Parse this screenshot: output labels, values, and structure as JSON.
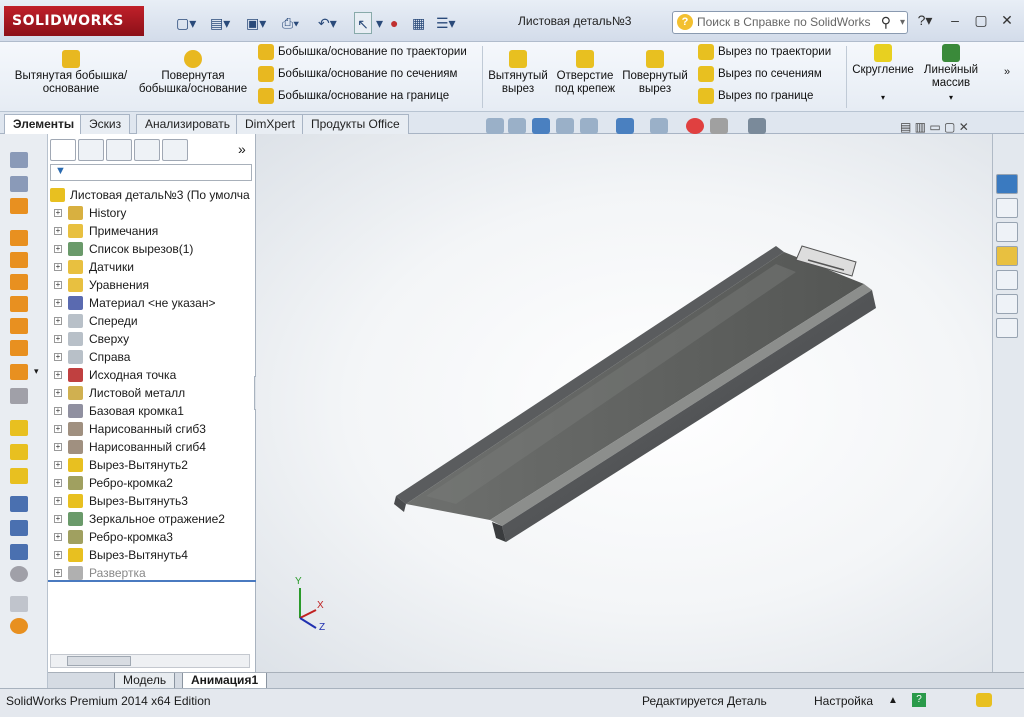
{
  "app": {
    "logo": "SOLIDWORKS",
    "doc_title": "Листовая деталь№3",
    "help_placeholder": "Поиск в Справке по SolidWorks"
  },
  "ribbon": {
    "extrude_boss": "Вытянутая бобышка/основание",
    "revolve_boss": "Повернутая бобышка/основание",
    "swept_boss": "Бобышка/основание по траектории",
    "loft_boss": "Бобышка/основание по сечениям",
    "boundary_boss": "Бобышка/основание на границе",
    "extrude_cut": "Вытянутый вырез",
    "hole_wizard": "Отверстие под крепеж",
    "revolve_cut": "Повернутый вырез",
    "swept_cut": "Вырез по траектории",
    "loft_cut": "Вырез по сечениям",
    "boundary_cut": "Вырез по границе",
    "fillet": "Скругление",
    "linear_pattern": "Линейный массив"
  },
  "tabs": [
    "Элементы",
    "Эскиз",
    "Анализировать",
    "DimXpert",
    "Продукты Office"
  ],
  "tree": {
    "root": "Листовая деталь№3  (По умолча",
    "items": [
      {
        "label": "History",
        "icon": "history-icon",
        "color": "#d8b040"
      },
      {
        "label": "Примечания",
        "icon": "annotations-icon",
        "color": "#e8c040"
      },
      {
        "label": "Список вырезов(1)",
        "icon": "cutlist-icon",
        "color": "#6a9a6a"
      },
      {
        "label": "Датчики",
        "icon": "sensor-icon",
        "color": "#e8c040"
      },
      {
        "label": "Уравнения",
        "icon": "equations-icon",
        "color": "#e8c040"
      },
      {
        "label": "Материал <не указан>",
        "icon": "material-icon",
        "color": "#5a6ab0"
      },
      {
        "label": "Спереди",
        "icon": "plane-icon",
        "color": "#b8c0c8"
      },
      {
        "label": "Сверху",
        "icon": "plane-icon",
        "color": "#b8c0c8"
      },
      {
        "label": "Справа",
        "icon": "plane-icon",
        "color": "#b8c0c8"
      },
      {
        "label": "Исходная точка",
        "icon": "origin-icon",
        "color": "#c04040"
      },
      {
        "label": "Листовой металл",
        "icon": "sheetmetal-icon",
        "color": "#d0b050"
      },
      {
        "label": "Базовая кромка1",
        "icon": "baseflange-icon",
        "color": "#9090a0"
      },
      {
        "label": "Нарисованный сгиб3",
        "icon": "sketchbend-icon",
        "color": "#a09080"
      },
      {
        "label": "Нарисованный сгиб4",
        "icon": "sketchbend-icon",
        "color": "#a09080"
      },
      {
        "label": "Вырез-Вытянуть2",
        "icon": "cut-icon",
        "color": "#e8c020"
      },
      {
        "label": "Ребро-кромка2",
        "icon": "edgeflange-icon",
        "color": "#a0a060"
      },
      {
        "label": "Вырез-Вытянуть3",
        "icon": "cut-icon",
        "color": "#e8c020"
      },
      {
        "label": "Зеркальное отражение2",
        "icon": "mirror-icon",
        "color": "#6a9a6a"
      },
      {
        "label": "Ребро-кромка3",
        "icon": "edgeflange-icon",
        "color": "#a0a060"
      },
      {
        "label": "Вырез-Вытянуть4",
        "icon": "cut-icon",
        "color": "#e8c020"
      },
      {
        "label": "Развертка",
        "icon": "flatpattern-icon",
        "color": "#b0b0b0"
      }
    ]
  },
  "bottom_tabs": [
    "Модель",
    "Анимация1"
  ],
  "status": {
    "edition": "SolidWorks Premium 2014 x64 Edition",
    "editing": "Редактируется Деталь",
    "settings": "Настройка"
  },
  "axes": {
    "x": "X",
    "y": "Y",
    "z": "Z"
  }
}
